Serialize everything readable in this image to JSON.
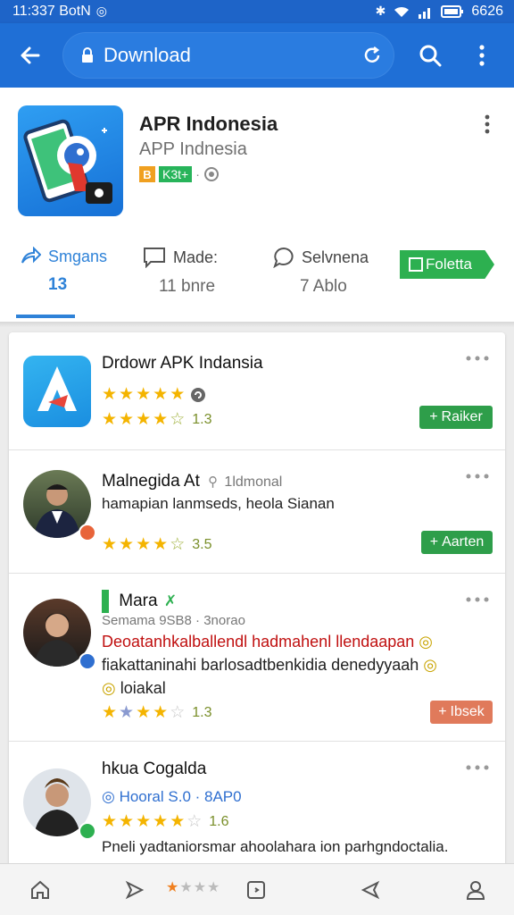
{
  "status_bar": {
    "time": "11:337 BotN",
    "right_text": "6626"
  },
  "browser": {
    "url": "Download"
  },
  "app": {
    "title": "APR Indonesia",
    "subtitle": "APP  Indnesia",
    "badge_letter": "B",
    "badge_green": "K3t+",
    "stats": [
      {
        "label": "Smgans",
        "value": "13"
      },
      {
        "label": "Made:",
        "value": "11 bnre"
      },
      {
        "label": "Selvnena",
        "value": "7 Ablo"
      }
    ],
    "follow_label": "Foletta"
  },
  "list": [
    {
      "title": "Drdowr APK Indansia",
      "rating_number": "1.3",
      "action": "Raiker"
    },
    {
      "title": "Malnegida At",
      "meta": "1ldmonal",
      "line1": "hamapian lanmseds, heola Sianan",
      "rating_number": "3.5",
      "action": "Aarten"
    },
    {
      "title": "Mara",
      "meta": "Semama 9SB8 · 3norao",
      "line_red": "Deoatanhkalballendl hadmahenl llendaapan",
      "line2": "fiakattaninahi barlosadtbenkidia denedyyaah",
      "line3": "loiakal",
      "rating_number": "1.3",
      "action": "Ibsek"
    },
    {
      "title": "hkua Cogalda",
      "meta": "Hooral S.0 · 8AP0",
      "rating_number": "1.6",
      "line1": "Pneli yadtaniorsmar ahoolahara ion parhgndoctalia."
    }
  ],
  "colors": {
    "primary": "#1f6fd6",
    "accent_green": "#2e9e4a",
    "star": "#f4b400",
    "salmon": "#e07a5b"
  },
  "icons": [
    "back-arrow-icon",
    "lock-icon",
    "reload-icon",
    "search-icon",
    "more-vert-icon",
    "home-icon",
    "share-icon",
    "tab-icon",
    "back-icon",
    "profile-icon"
  ]
}
